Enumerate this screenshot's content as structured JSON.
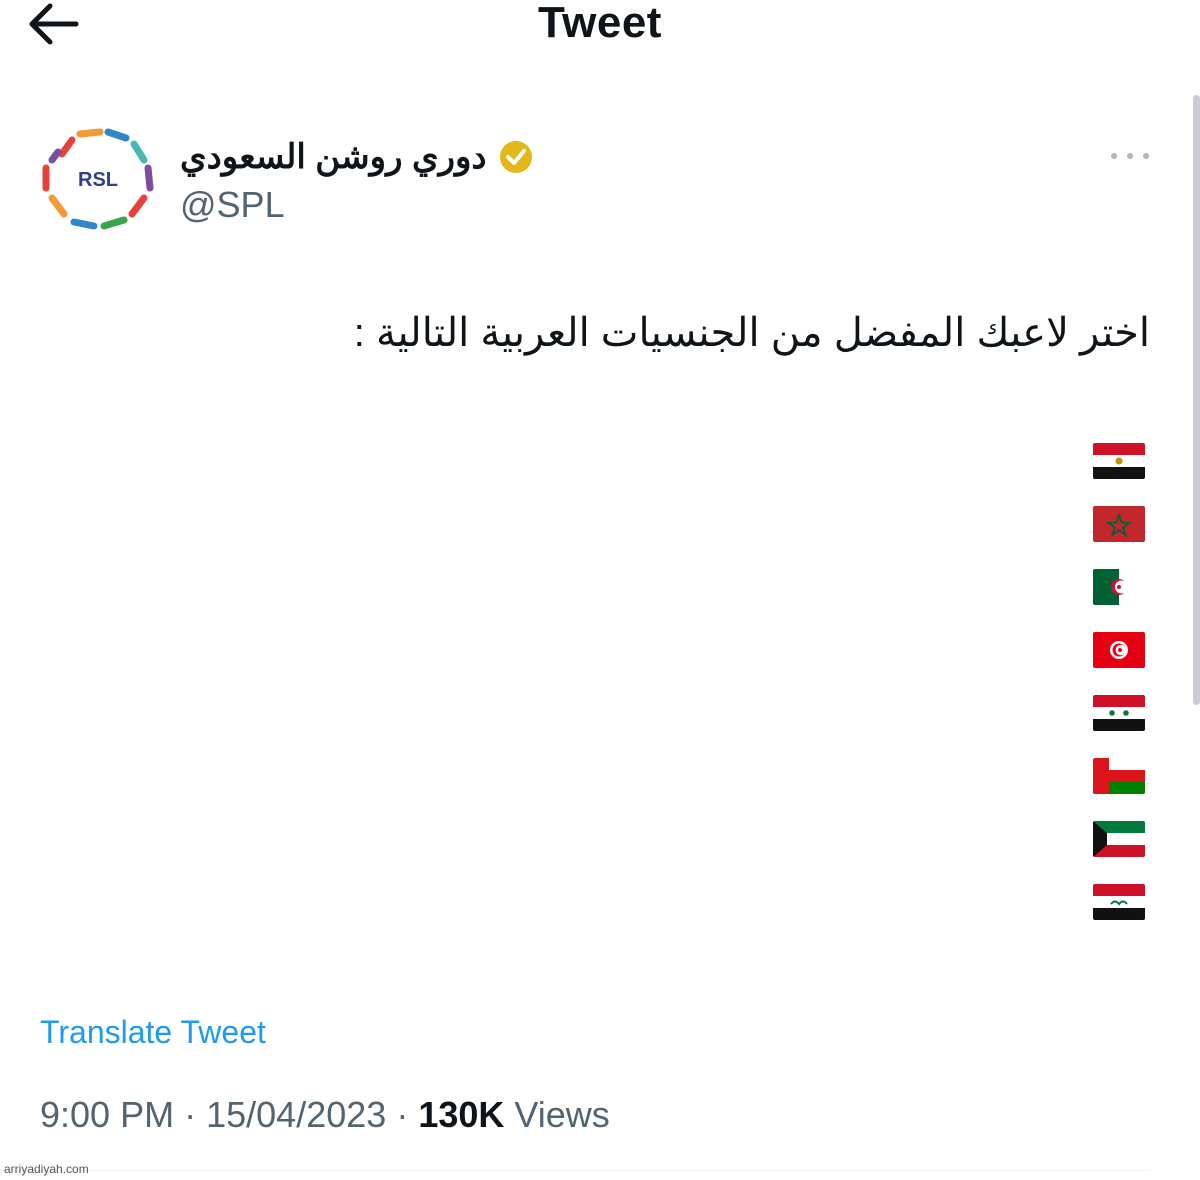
{
  "header": {
    "title": "Tweet",
    "back_icon": "arrow-left-icon"
  },
  "tweet": {
    "author": {
      "display_name": "دوري روشن السعودي",
      "handle": "@SPL",
      "verified": true,
      "verified_color": "#e2b719",
      "avatar_text": "RSL"
    },
    "text": "اختر لاعبك المفضل من الجنسيات العربية التالية :",
    "flags": [
      "Egypt",
      "Morocco",
      "Algeria",
      "Tunisia",
      "Syria",
      "Oman",
      "Kuwait",
      "Iraq"
    ],
    "translate_label": "Translate Tweet",
    "time": "9:00 PM",
    "separator": "·",
    "date": "15/04/2023",
    "views_count": "130K",
    "views_label": "Views"
  },
  "colors": {
    "accent": "#1d9bf0",
    "muted": "#536471",
    "text": "#0f1419"
  },
  "watermark": "arriyadiyah.com"
}
